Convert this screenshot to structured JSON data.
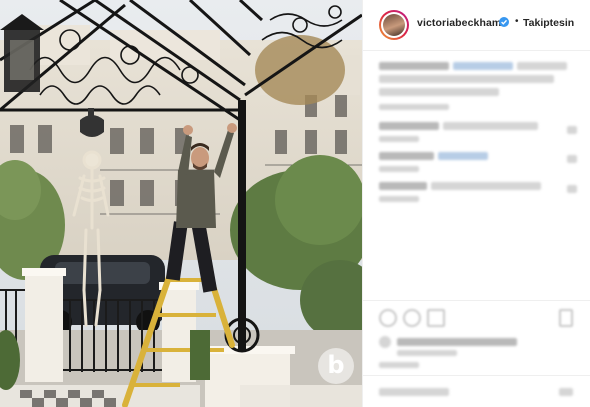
{
  "post": {
    "username": "victoriabeckham",
    "dot": "•",
    "follow_label": "Takiptesin",
    "watermark_letter": "b",
    "verified_color": "#3897f0"
  },
  "icons": {
    "verified": "verified-badge-icon",
    "like": "heart-icon",
    "comment": "comment-icon",
    "share": "share-icon",
    "save": "bookmark-icon",
    "more": "more-options-icon"
  }
}
